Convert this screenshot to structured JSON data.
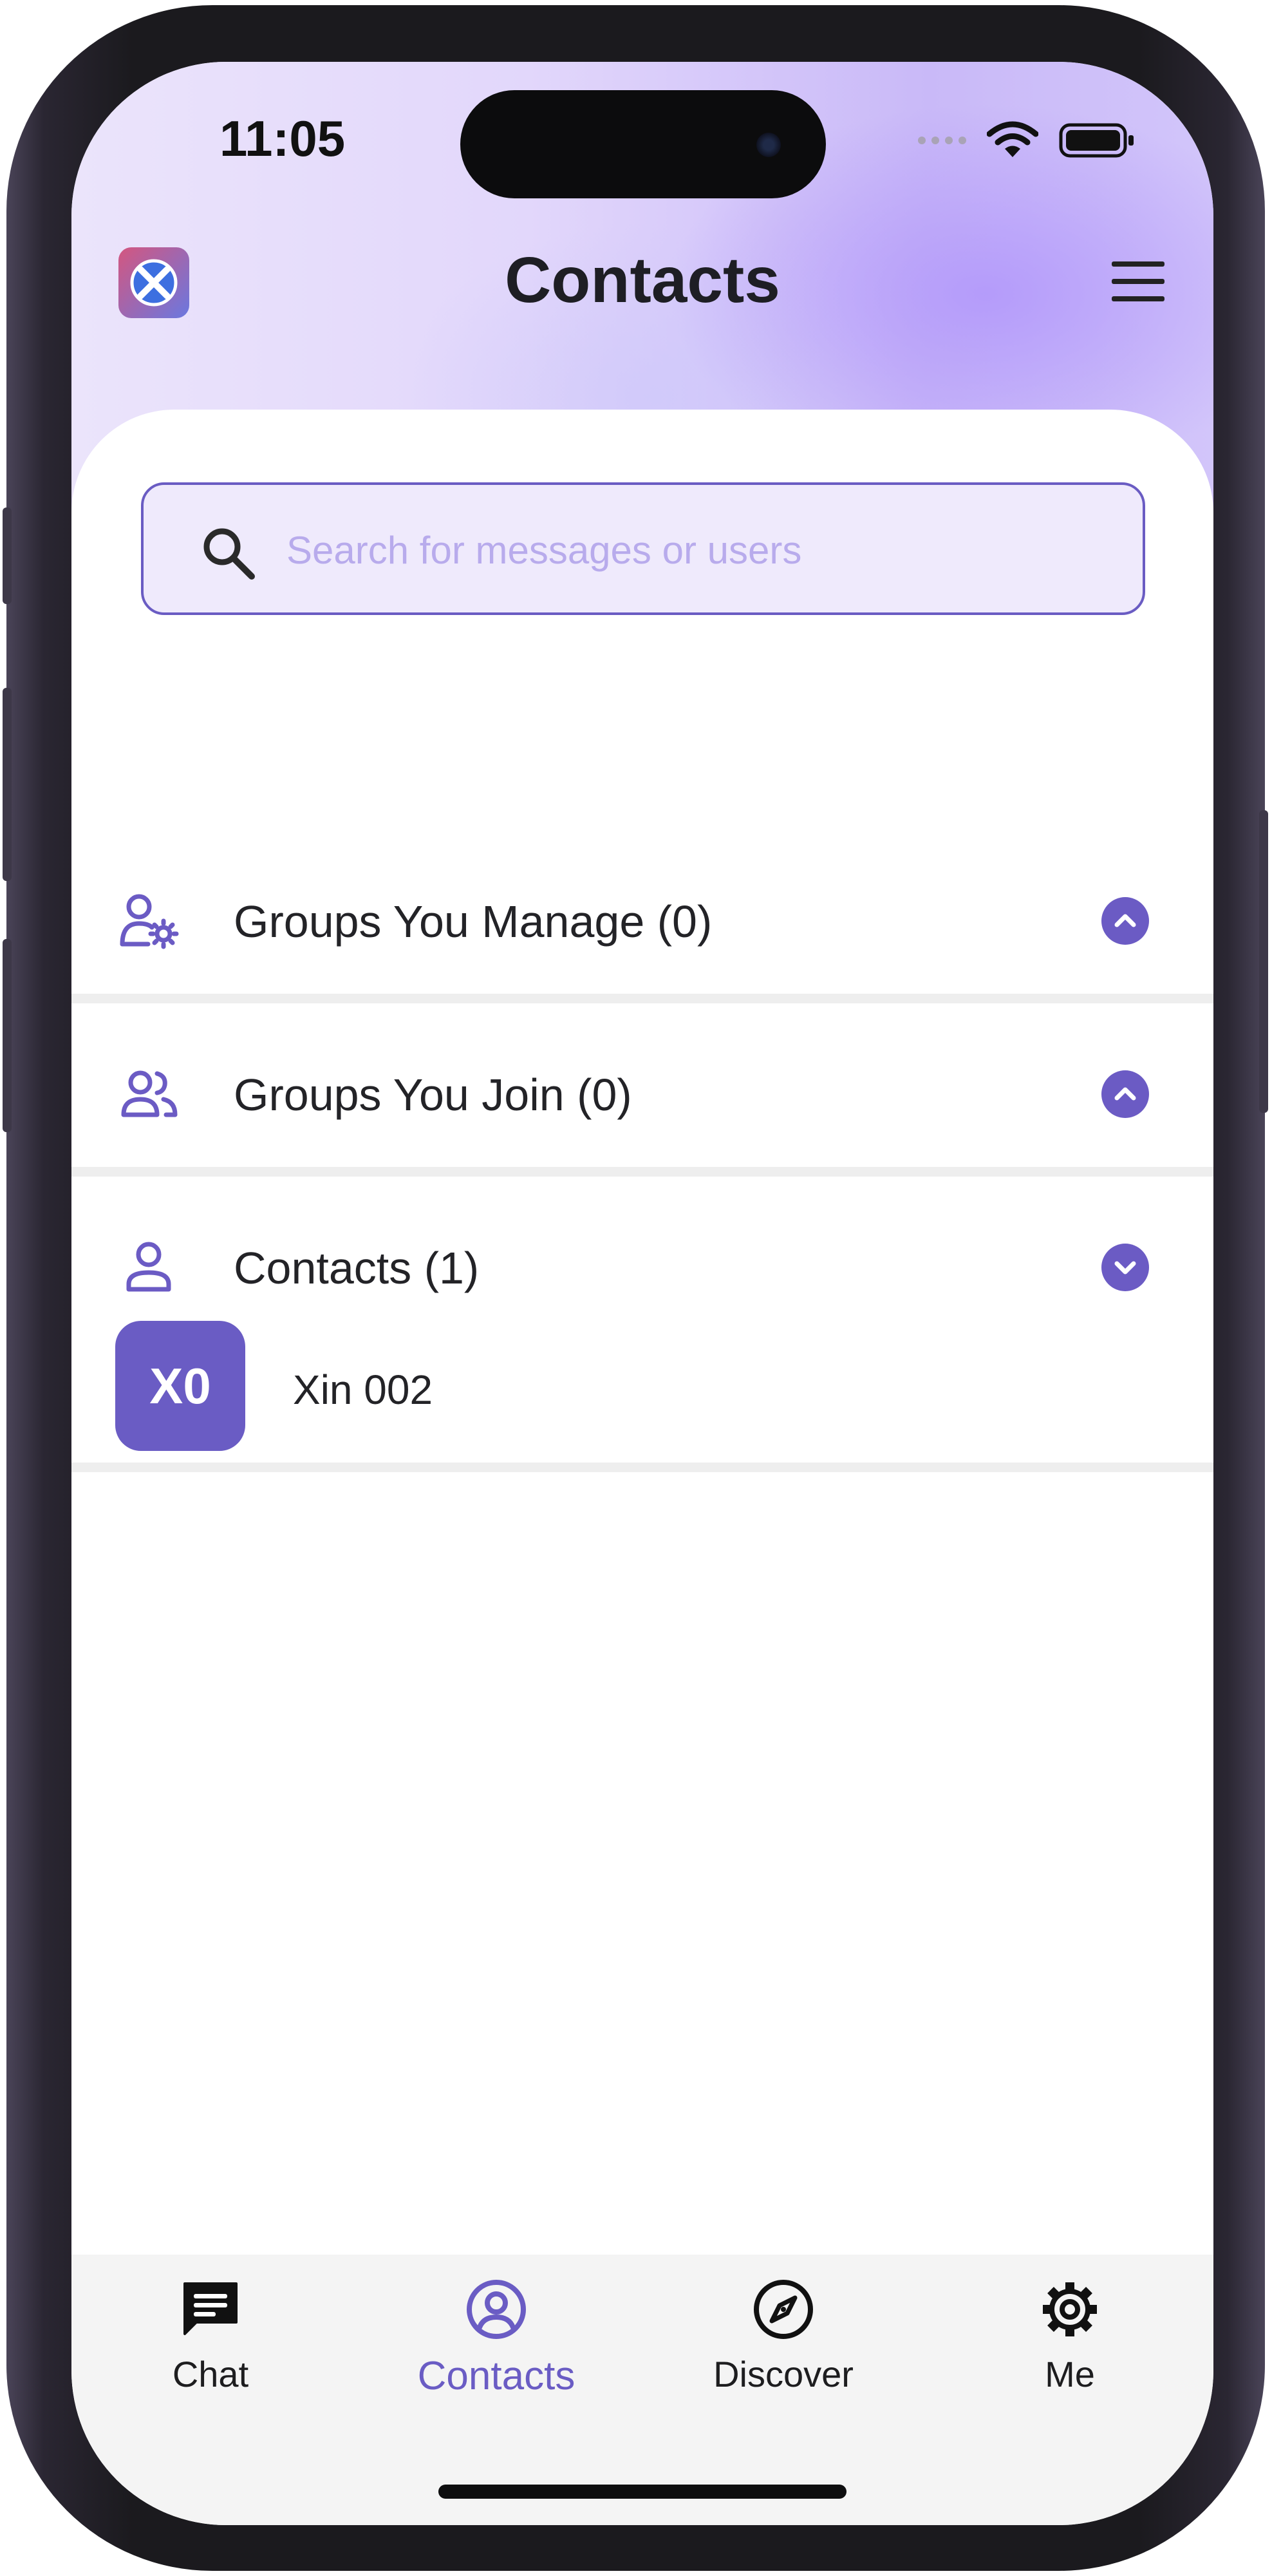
{
  "status_bar": {
    "time": "11:05"
  },
  "header": {
    "title": "Contacts",
    "logo_icon": "app-logo-icon",
    "menu_icon": "hamburger-menu-icon"
  },
  "search": {
    "placeholder": "Search for messages or users",
    "value": ""
  },
  "sections": [
    {
      "label": "Groups You Manage (0)",
      "icon": "user-gear-icon",
      "expanded": false
    },
    {
      "label": "Groups You Join (0)",
      "icon": "users-group-icon",
      "expanded": false
    },
    {
      "label": "Contacts (1)",
      "icon": "person-icon",
      "expanded": true
    }
  ],
  "contacts": [
    {
      "initials": "X0",
      "name": "Xin 002"
    }
  ],
  "tabs": [
    {
      "label": "Chat",
      "icon": "chat-bubble-icon",
      "active": false
    },
    {
      "label": "Contacts",
      "icon": "contacts-circle-icon",
      "active": true
    },
    {
      "label": "Discover",
      "icon": "compass-icon",
      "active": false
    },
    {
      "label": "Me",
      "icon": "gear-icon",
      "active": false
    }
  ],
  "colors": {
    "accent": "#6a5cc4",
    "search_bg": "#efeafc",
    "divider": "#eeeeee",
    "tab_bar_bg": "#f4f4f4"
  }
}
